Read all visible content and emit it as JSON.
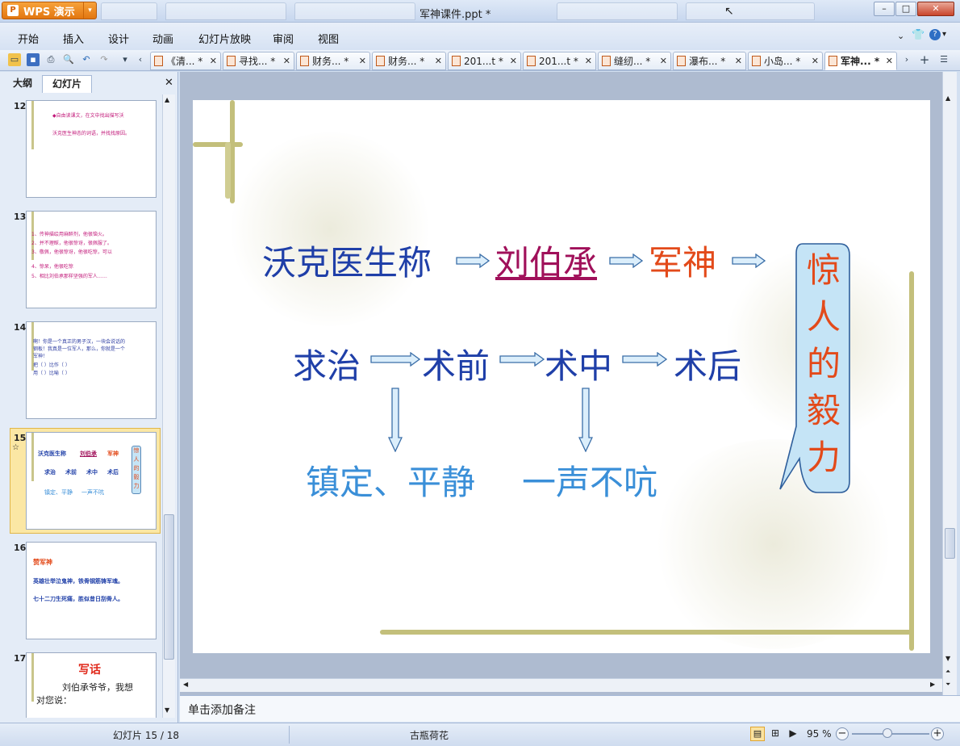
{
  "app": {
    "name": "WPS 演示",
    "doc_title": "军神课件.ppt *"
  },
  "window_buttons": {
    "minimize": "–",
    "maximize": "□",
    "close": "✕"
  },
  "menu": [
    "开始",
    "插入",
    "设计",
    "动画",
    "幻灯片放映",
    "审阅",
    "视图"
  ],
  "doc_tabs": [
    {
      "label": "《清...",
      "modified": "*"
    },
    {
      "label": "寻找...",
      "modified": "*"
    },
    {
      "label": "财务...",
      "modified": "*"
    },
    {
      "label": "财务...",
      "modified": "*"
    },
    {
      "label": "201...t",
      "modified": "*"
    },
    {
      "label": "201...t",
      "modified": "*"
    },
    {
      "label": "缝纫...",
      "modified": "*"
    },
    {
      "label": "瀑布...",
      "modified": "*"
    },
    {
      "label": "小岛...",
      "modified": "*"
    },
    {
      "label": "军神...",
      "modified": "*"
    }
  ],
  "panel": {
    "tab_outline": "大纲",
    "tab_slides": "幻灯片",
    "close": "✕"
  },
  "thumbnails": [
    {
      "num": "12",
      "lines": [
        "◆自由读课文，在文中找出描写沃",
        "沃克医生神态的词语，并找找原因。"
      ]
    },
    {
      "num": "13",
      "lines": [
        "1、传神描绘用麻醉剂，他很恼火。",
        "2、并不理睬，他很惊讶，很佩服了。",
        "3、敬佩，他很惊讶，他很吃惊，可以",
        "4、惊呆，他很吃惊",
        "5、相比刘伯承那样坚强的军人……"
      ]
    },
    {
      "num": "14",
      "lines": [
        "啊！你是一个真正的男子汉，一块会说话的",
        "钢板！我真是一位军人，那么，你就是一个",
        "军神！",
        "把（        ）比作（        ）",
        "用（        ）比喻（        ）"
      ]
    },
    {
      "num": "15",
      "star": "☆",
      "lines": [
        "沃克医生称",
        "刘伯承",
        "军神",
        "求治",
        "术前",
        "术中",
        "术后",
        "镇定、平静",
        "一声不吭",
        "惊人的毅力"
      ]
    },
    {
      "num": "16",
      "lines": [
        "赞军神",
        "英雄壮举泣鬼神，铁骨钢筋铸军魂。",
        "七十二刀生死痛，胜似昔日刮骨人。"
      ]
    },
    {
      "num": "17",
      "lines": [
        "写话",
        "刘伯承爷爷，我想",
        "对您说："
      ]
    }
  ],
  "slide": {
    "row1": {
      "a": "沃克医生称",
      "b": "刘伯承",
      "c": "军神"
    },
    "row2": [
      "求治",
      "术前",
      "术中",
      "术后"
    ],
    "row3": {
      "a": "镇定、平静",
      "b": "一声不吭"
    },
    "callout": [
      "惊",
      "人",
      "的",
      "毅",
      "力"
    ]
  },
  "notes_placeholder": "单击添加备注",
  "status": {
    "slide_count": "幻灯片 15 / 18",
    "theme": "古瓶荷花",
    "zoom": "95 %"
  },
  "colors": {
    "blue": "#1f3fa8",
    "light_blue": "#3a8fd8",
    "red": "#e34a1a",
    "magenta": "#a0105a",
    "callout_bg": "#c5e4f6"
  }
}
